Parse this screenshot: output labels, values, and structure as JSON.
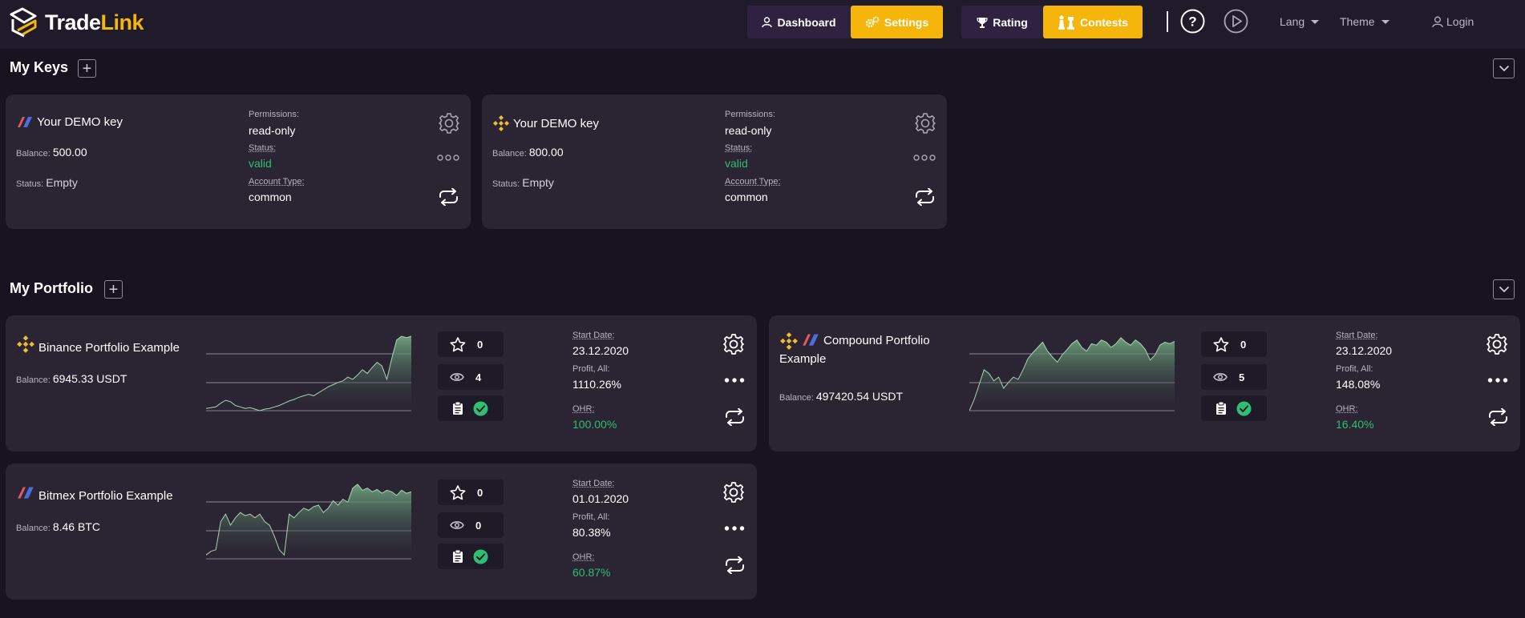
{
  "header": {
    "brand_trade": "Trade",
    "brand_link": "Link",
    "nav": {
      "dashboard": "Dashboard",
      "settings": "Settings",
      "rating": "Rating",
      "contests": "Contests"
    },
    "lang": "Lang",
    "theme": "Theme",
    "login": "Login",
    "separator": "|"
  },
  "keys_section": {
    "title": "My Keys",
    "add_symbol": "+",
    "cards": [
      {
        "exchange": "bitmex",
        "name": "Your DEMO key",
        "balance_label": "Balance:",
        "balance": "500.00",
        "status_label": "Status:",
        "status": "Empty",
        "permissions_label": "Permissions:",
        "permissions": "read-only",
        "key_status_label": "Status:",
        "key_status": "valid",
        "account_type_label": "Account Type:",
        "account_type": "common"
      },
      {
        "exchange": "binance",
        "name": "Your DEMO key",
        "balance_label": "Balance:",
        "balance": "800.00",
        "status_label": "Status:",
        "status": "Empty",
        "permissions_label": "Permissions:",
        "permissions": "read-only",
        "key_status_label": "Status:",
        "key_status": "valid",
        "account_type_label": "Account Type:",
        "account_type": "common"
      }
    ]
  },
  "portfolio_section": {
    "title": "My Portfolio",
    "add_symbol": "+",
    "cards": [
      {
        "exchanges": [
          "binance"
        ],
        "name": "Binance Portfolio Example",
        "balance_label": "Balance:",
        "balance": "6945.33 USDT",
        "stars": "0",
        "views": "4",
        "start_label": "Start Date:",
        "start_date": "23.12.2020",
        "profit_label": "Profit, All:",
        "profit": "1110.26%",
        "ohr_label": "OHR:",
        "ohr": "100.00%",
        "chart_values": [
          0.03,
          0.04,
          0.05,
          0.1,
          0.14,
          0.12,
          0.07,
          0.05,
          0.03,
          0.04,
          0.02,
          0.0,
          0.02,
          0.03,
          0.05,
          0.07,
          0.1,
          0.13,
          0.15,
          0.18,
          0.2,
          0.22,
          0.2,
          0.24,
          0.28,
          0.32,
          0.35,
          0.38,
          0.4,
          0.45,
          0.42,
          0.48,
          0.55,
          0.5,
          0.58,
          0.65,
          0.6,
          0.42,
          0.7,
          0.95,
          1.0,
          0.98,
          1.0
        ]
      },
      {
        "exchanges": [
          "binance",
          "bitmex"
        ],
        "name": "Compound Portfolio Example",
        "balance_label": "Balance:",
        "balance": "497420.54 USDT",
        "stars": "0",
        "views": "5",
        "start_label": "Start Date:",
        "start_date": "23.12.2020",
        "profit_label": "Profit, All:",
        "profit": "148.08%",
        "ohr_label": "OHR:",
        "ohr": "16.40%",
        "chart_values": [
          0.0,
          0.15,
          0.35,
          0.55,
          0.5,
          0.4,
          0.45,
          0.3,
          0.38,
          0.45,
          0.42,
          0.55,
          0.7,
          0.78,
          0.85,
          0.92,
          0.8,
          0.72,
          0.65,
          0.75,
          0.82,
          0.9,
          0.95,
          0.85,
          0.8,
          0.9,
          0.88,
          0.95,
          0.92,
          0.85,
          0.9,
          0.98,
          0.92,
          0.88,
          0.95,
          0.9,
          0.82,
          0.68,
          0.75,
          0.88,
          0.92,
          0.9,
          0.93
        ]
      },
      {
        "exchanges": [
          "bitmex"
        ],
        "name": "Bitmex Portfolio Example",
        "balance_label": "Balance:",
        "balance": "8.46 BTC",
        "stars": "0",
        "views": "0",
        "start_label": "Start Date:",
        "start_date": "01.01.2020",
        "profit_label": "Profit, All:",
        "profit": "80.38%",
        "ohr_label": "OHR:",
        "ohr": "60.87%",
        "chart_values": [
          0.05,
          0.1,
          0.12,
          0.5,
          0.6,
          0.45,
          0.55,
          0.62,
          0.58,
          0.6,
          0.55,
          0.6,
          0.5,
          0.45,
          0.3,
          0.12,
          0.05,
          0.6,
          0.55,
          0.62,
          0.68,
          0.65,
          0.7,
          0.72,
          0.62,
          0.68,
          0.78,
          0.72,
          0.8,
          0.76,
          0.95,
          1.0,
          0.92,
          0.95,
          0.9,
          0.93,
          0.88,
          0.92,
          0.9,
          0.85,
          0.92,
          0.88,
          0.9
        ]
      }
    ]
  }
}
